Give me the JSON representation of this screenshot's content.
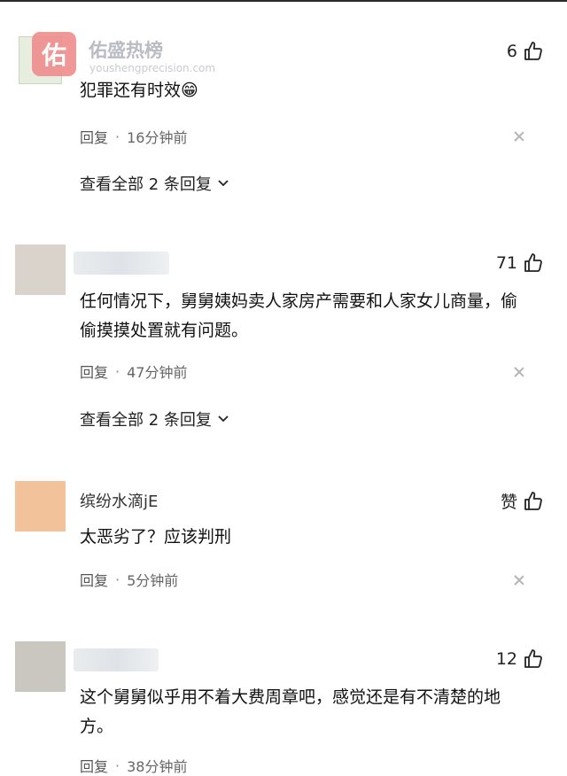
{
  "watermark": {
    "logo_char": "佑",
    "title": "佑盛热榜",
    "url": "youshengprecision.com"
  },
  "comments": [
    {
      "username": "",
      "likes": "6",
      "text": "犯罪还有时效😁",
      "reply_label": "回复",
      "time": "16分钟前",
      "view_replies": "查看全部 2 条回复",
      "avatar_color": "#e6eedd"
    },
    {
      "username": "",
      "likes": "71",
      "text": "任何情况下，舅舅姨妈卖人家房产需要和人家女儿商量，偷偷摸摸处置就有问题。",
      "reply_label": "回复",
      "time": "47分钟前",
      "view_replies": "查看全部 2 条回复",
      "avatar_color": "#d9d3cb"
    },
    {
      "username": "缤纷水滴jE",
      "likes": "赞",
      "text": "太恶劣了？应该判刑",
      "reply_label": "回复",
      "time": "5分钟前",
      "view_replies": "",
      "avatar_color": "#f2c39a"
    },
    {
      "username": "",
      "likes": "12",
      "text": "这个舅舅似乎用不着大费周章吧，感觉还是有不清楚的地方。",
      "reply_label": "回复",
      "time": "38分钟前",
      "view_replies": "",
      "avatar_color": "#c9c7bf"
    }
  ]
}
